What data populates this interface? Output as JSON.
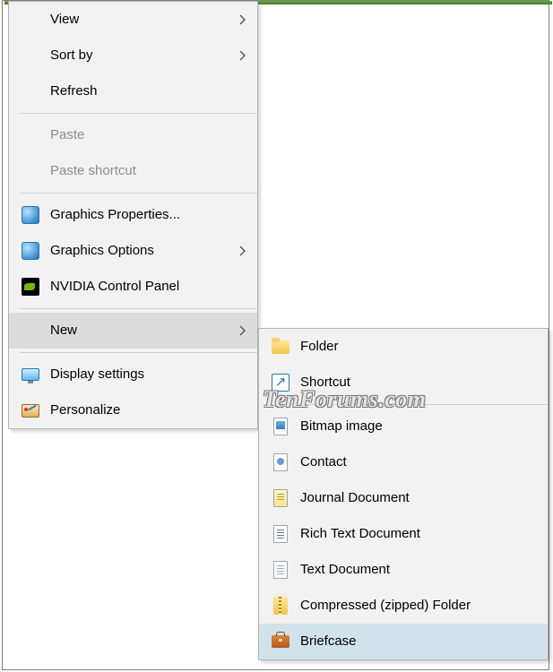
{
  "watermark": "TenForums.com",
  "main_menu": {
    "view": "View",
    "sort_by": "Sort by",
    "refresh": "Refresh",
    "paste": "Paste",
    "paste_shortcut": "Paste shortcut",
    "gfx_props": "Graphics Properties...",
    "gfx_options": "Graphics Options",
    "nvidia": "NVIDIA Control Panel",
    "new": "New",
    "display": "Display settings",
    "personalize": "Personalize"
  },
  "new_submenu": {
    "folder": "Folder",
    "shortcut": "Shortcut",
    "bitmap": "Bitmap image",
    "contact": "Contact",
    "journal": "Journal Document",
    "rtf": "Rich Text Document",
    "txt": "Text Document",
    "zip": "Compressed (zipped) Folder",
    "briefcase": "Briefcase"
  }
}
